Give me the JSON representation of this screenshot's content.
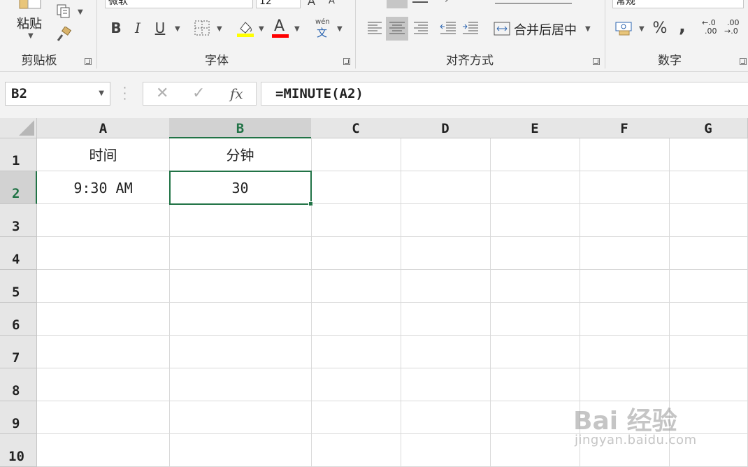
{
  "ribbon": {
    "clipboard": {
      "label": "剪贴板",
      "paste_label": "粘贴"
    },
    "font": {
      "label": "字体",
      "font_name": "微软",
      "font_size": "12",
      "bold": "B",
      "italic": "I",
      "underline": "U",
      "font_color_letter": "A",
      "phonetic_top": "wén",
      "phonetic_bottom": "文",
      "fill_color": "#ffff00",
      "font_color": "#ff0000"
    },
    "alignment": {
      "label": "对齐方式",
      "merge_center": "合并后居中"
    },
    "number": {
      "label": "数字",
      "format": "常规",
      "percent": "%",
      "comma": ",",
      "inc_decimal_top": "←.0",
      "inc_decimal_bottom": ".00",
      "dec_decimal_top": ".00",
      "dec_decimal_bottom": "→.0"
    }
  },
  "formula_bar": {
    "name_box": "B2",
    "fx": "fx",
    "formula": "=MINUTE(A2)"
  },
  "sheet": {
    "columns": [
      "A",
      "B",
      "C",
      "D",
      "E",
      "F",
      "G"
    ],
    "rows": [
      "1",
      "2",
      "3",
      "4",
      "5",
      "6",
      "7",
      "8",
      "9",
      "10"
    ],
    "cells": {
      "A1": "时间",
      "B1": "分钟",
      "A2": "9:30 AM",
      "B2": "30"
    },
    "selected_cell": "B2",
    "accent": "#217346"
  },
  "watermark": {
    "brand": "Bai 经验",
    "url": "jingyan.baidu.com"
  }
}
